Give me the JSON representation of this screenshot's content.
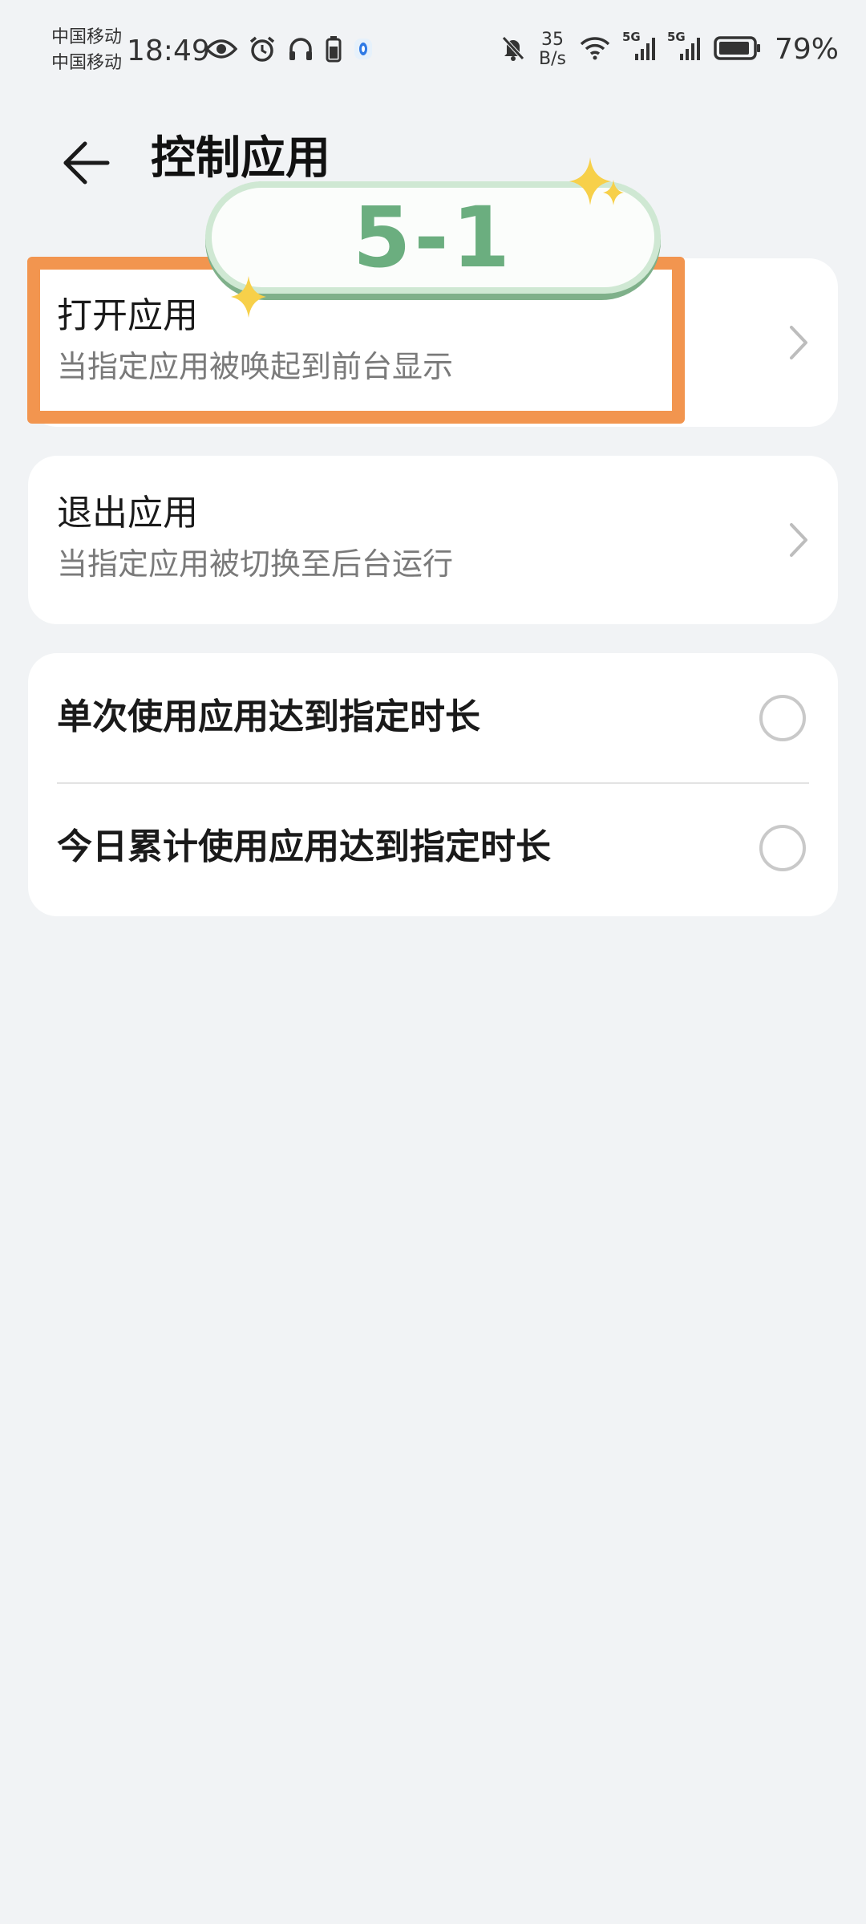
{
  "status_bar": {
    "carrier_1": "中国移动",
    "carrier_2": "中国移动",
    "time": "18:49",
    "net_speed_value": "35",
    "net_speed_unit": "B/s",
    "signal_1_label": "5G",
    "signal_2_label": "5G",
    "battery_percent": "79%",
    "icons_left": [
      "eye-icon",
      "alarm-icon",
      "headphones-icon",
      "battery-small-icon",
      "app-notification-icon"
    ],
    "icons_right": [
      "mute-bell-icon",
      "wifi-icon",
      "signal-icon",
      "signal-icon",
      "battery-icon"
    ]
  },
  "header": {
    "title": "控制应用",
    "back_icon": "arrow-left-icon"
  },
  "rows": {
    "open_app": {
      "title": "打开应用",
      "subtitle": "当指定应用被唤起到前台显示"
    },
    "exit_app": {
      "title": "退出应用",
      "subtitle": "当指定应用被切换至后台运行"
    }
  },
  "options": [
    {
      "label": "单次使用应用达到指定时长",
      "selected": false
    },
    {
      "label": "今日累计使用应用达到指定时长",
      "selected": false
    }
  ],
  "overlay": {
    "step_label": "5-1",
    "highlight_color": "#f2954f",
    "badge_text_color": "#6bae7f",
    "sparkle_color": "#f7d04a"
  }
}
